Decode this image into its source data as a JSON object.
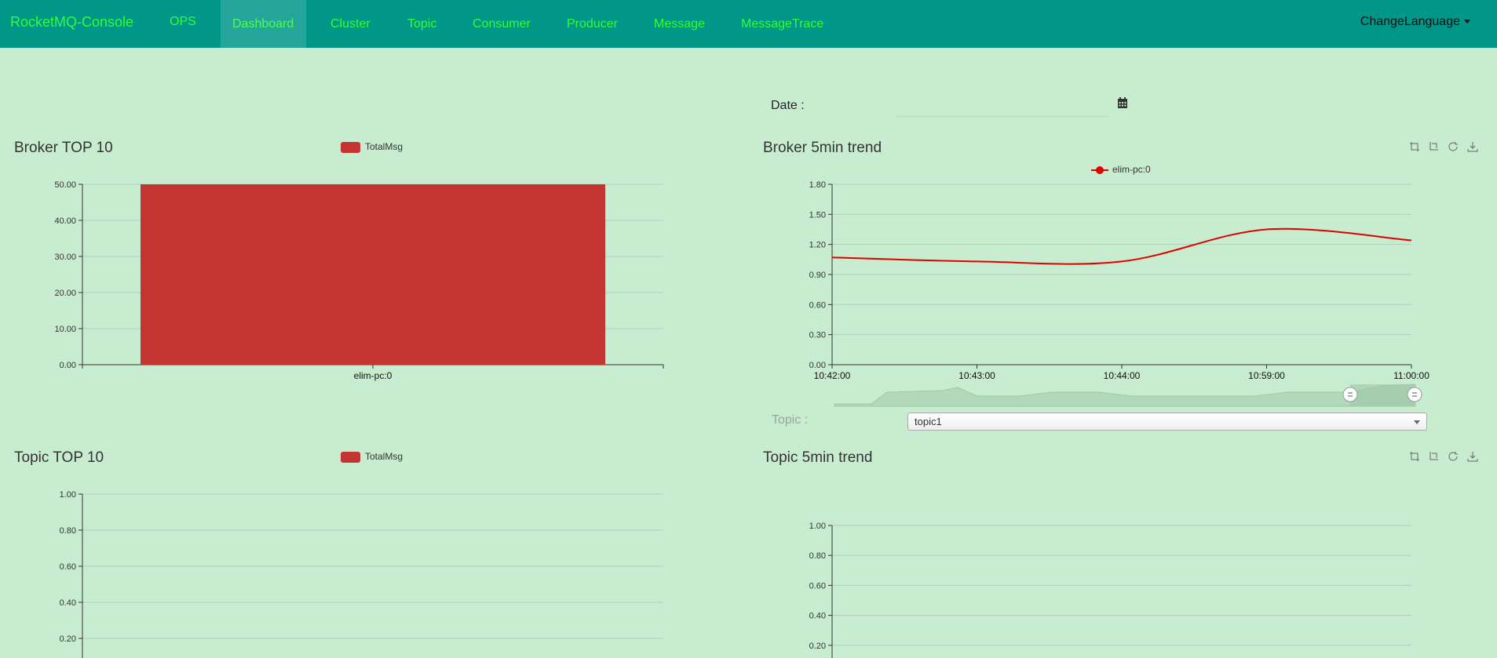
{
  "nav": {
    "brand": "RocketMQ-Console",
    "items": [
      "OPS",
      "Dashboard",
      "Cluster",
      "Topic",
      "Consumer",
      "Producer",
      "Message",
      "MessageTrace"
    ],
    "active": "Dashboard",
    "change_language": "ChangeLanguage"
  },
  "filters": {
    "date_label": "Date :",
    "date_value": "",
    "topic_label": "Topic :",
    "topic_selected": "topic1"
  },
  "icons": [
    "calendar-icon",
    "zoom-icon",
    "zoom-reset-icon",
    "restore-icon",
    "save-image-icon"
  ],
  "colors": {
    "navbar": "#009688",
    "nav_text": "#33ff33",
    "bar": "#c23531",
    "line": "#e00000",
    "background": "#c8ecd0"
  },
  "chart_data": [
    {
      "id": "broker_top10",
      "type": "bar",
      "title": "Broker TOP 10",
      "legend": [
        "TotalMsg"
      ],
      "categories": [
        "elim-pc:0"
      ],
      "series": [
        {
          "name": "TotalMsg",
          "values": [
            50
          ]
        }
      ],
      "ylim": [
        0,
        50
      ],
      "yticks": [
        "0.00",
        "10.00",
        "20.00",
        "30.00",
        "40.00",
        "50.00"
      ],
      "grid": true
    },
    {
      "id": "broker_5min_trend",
      "type": "line",
      "title": "Broker 5min trend",
      "legend": [
        "elim-pc:0"
      ],
      "x": [
        "10:42:00",
        "10:43:00",
        "10:44:00",
        "10:59:00",
        "11:00:00"
      ],
      "series": [
        {
          "name": "elim-pc:0",
          "values": [
            1.07,
            1.03,
            1.03,
            1.35,
            1.24
          ]
        }
      ],
      "ylim": [
        0,
        1.8
      ],
      "yticks": [
        "0.00",
        "0.30",
        "0.60",
        "0.90",
        "1.20",
        "1.50",
        "1.80"
      ],
      "grid": true,
      "data_zoom": true
    },
    {
      "id": "topic_top10",
      "type": "bar",
      "title": "Topic TOP 10",
      "legend": [
        "TotalMsg"
      ],
      "categories": [],
      "series": [
        {
          "name": "TotalMsg",
          "values": []
        }
      ],
      "ylim": [
        0,
        1
      ],
      "yticks": [
        "0.20",
        "0.40",
        "0.60",
        "0.80",
        "1.00"
      ],
      "grid": true
    },
    {
      "id": "topic_5min_trend",
      "type": "line",
      "title": "Topic 5min trend",
      "legend": [],
      "x": [],
      "series": [],
      "ylim": [
        0,
        1
      ],
      "yticks": [
        "0.20",
        "0.40",
        "0.60",
        "0.80",
        "1.00"
      ],
      "grid": true
    }
  ]
}
